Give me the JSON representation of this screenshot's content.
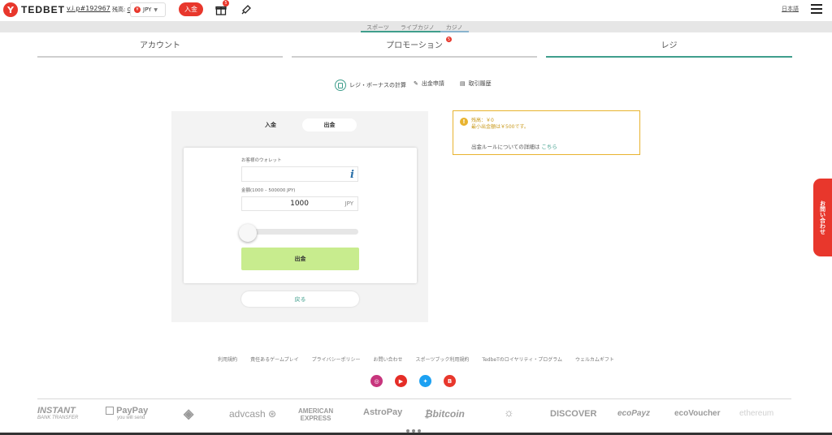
{
  "brand": {
    "name": "TEDBET"
  },
  "header": {
    "vip_id": "v.i.p#192967",
    "balance_label": "残高:",
    "balance_value": "0",
    "currency": "JPY",
    "deposit_label": "入金",
    "gift_badge": "5",
    "language": "日本語"
  },
  "category_tabs": [
    "スポーツ",
    "ライブカジノ",
    "カジノ"
  ],
  "main_tabs": {
    "account": "アカウント",
    "promotion": "プロモーション",
    "promotion_badge": "5",
    "cashier": "レジ"
  },
  "subnav": {
    "bonus_calc": "レジ・ボーナスの計算",
    "withdraw_request": "出金申請",
    "history": "取引履歴"
  },
  "panel": {
    "tab_deposit": "入金",
    "tab_withdraw": "出金",
    "wallet_label": "お客様のウォレット",
    "wallet_value": "",
    "amount_label": "金額(1000 – 500000 JPY)",
    "amount_value": "1000",
    "amount_currency": "JPY",
    "slider_value_fraction": 0,
    "withdraw_button": "出金",
    "back_button": "戻る"
  },
  "notice": {
    "balance_line": "残高：￥0",
    "min_line": "最小出金額は￥500です。",
    "rule_text": "出金ルールについての詳細は",
    "rule_link": "こちら"
  },
  "contact": "お問い合わせ",
  "footer_links": [
    "利用規約",
    "責任あるゲームプレイ",
    "プライバシーポリシー",
    "お問い合わせ",
    "スポーツブック利用規約",
    "TedbeTのロイヤリティ・プログラム",
    "ウェルカムギフト"
  ],
  "payments": {
    "instant": "INSTANT",
    "instant_sub": "BANK TRANSFER",
    "paypay": "PayPay",
    "paypay_sub": "you will send",
    "advcash": "advcash",
    "amex_1": "AMERICAN",
    "amex_2": "EXPRESS",
    "astropay": "AstroPay",
    "bitcoin": "bitcoin",
    "discover": "DISCOVER",
    "ecopayz": "ecoPayz",
    "ecovoucher": "ecoVoucher",
    "ethereum": "ethereum"
  },
  "colors": {
    "brand_red": "#e8372c",
    "accent_teal": "#3f9e8c",
    "withdraw_green": "#c8ec8e",
    "notice_yellow": "#e8b32f"
  }
}
